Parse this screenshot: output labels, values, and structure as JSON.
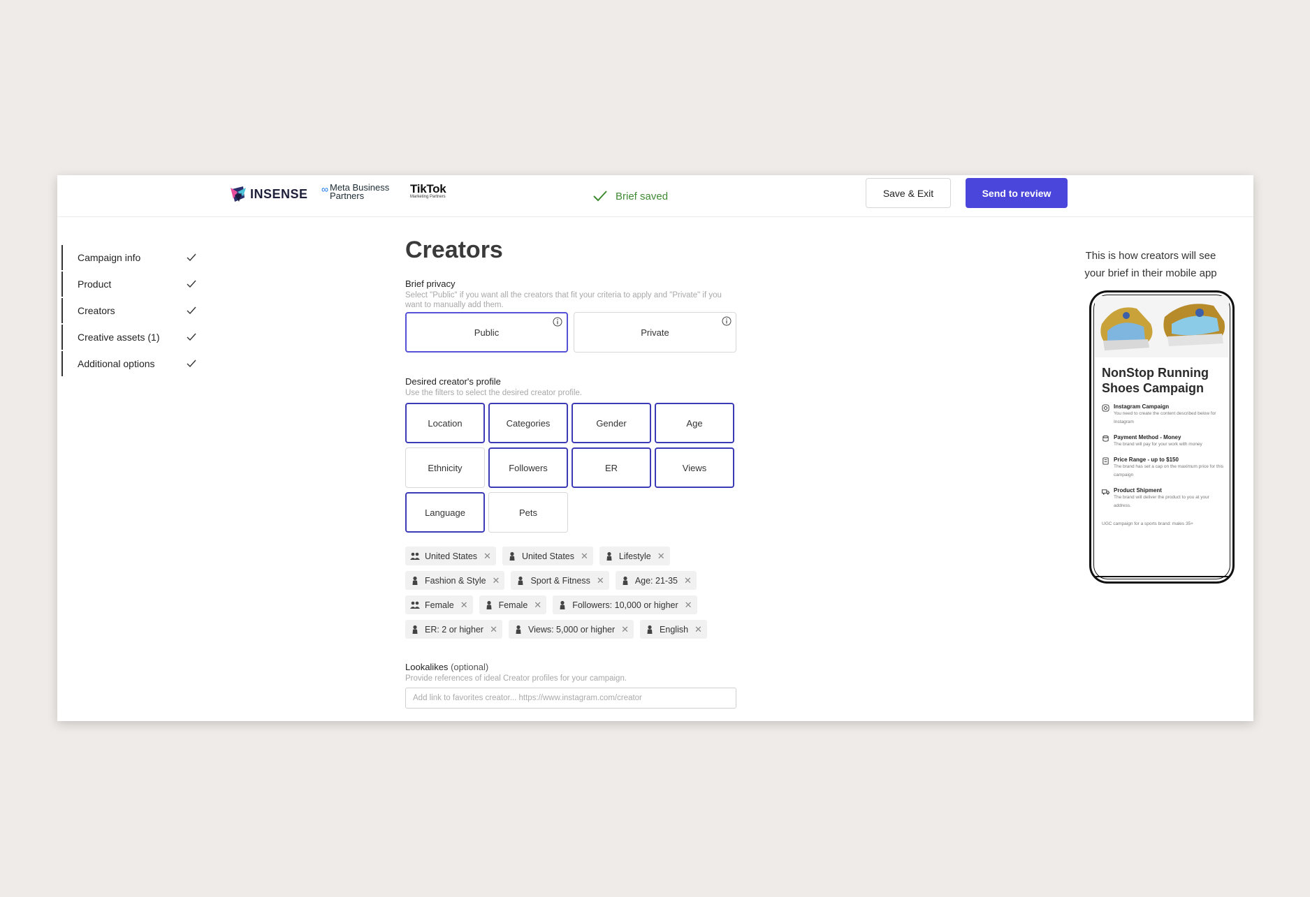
{
  "header": {
    "brand": "INSENSE",
    "meta_partner": [
      "Meta Business",
      "Partners"
    ],
    "meta_symbol": "∞",
    "tiktok_name": "TikTok",
    "tiktok_sub": "Marketing Partners",
    "saved_status": "Brief saved",
    "save_exit_label": "Save & Exit",
    "send_review_label": "Send to review"
  },
  "sidebar": {
    "items": [
      {
        "label": "Campaign info"
      },
      {
        "label": "Product"
      },
      {
        "label": "Creators"
      },
      {
        "label": "Creative assets (1)"
      },
      {
        "label": "Additional options"
      }
    ]
  },
  "main": {
    "title": "Creators",
    "privacy": {
      "label": "Brief privacy",
      "help": "Select \"Public\" if you want all the creators that fit your criteria to apply and \"Private\" if you want to manually add them.",
      "options": [
        {
          "label": "Public",
          "selected": true
        },
        {
          "label": "Private",
          "selected": false
        }
      ]
    },
    "profile": {
      "label": "Desired creator's profile",
      "help": "Use the filters to select the desired creator profile.",
      "filters": [
        {
          "label": "Location",
          "active": true
        },
        {
          "label": "Categories",
          "active": true
        },
        {
          "label": "Gender",
          "active": true
        },
        {
          "label": "Age",
          "active": true
        },
        {
          "label": "Ethnicity",
          "active": false
        },
        {
          "label": "Followers",
          "active": true
        },
        {
          "label": "ER",
          "active": true
        },
        {
          "label": "Views",
          "active": true
        },
        {
          "label": "Language",
          "active": true
        },
        {
          "label": "Pets",
          "active": false
        }
      ]
    },
    "tags": [
      {
        "icon": "audience-icon",
        "label": "United States"
      },
      {
        "icon": "creator-icon",
        "label": "United States"
      },
      {
        "icon": "creator-icon",
        "label": "Lifestyle"
      },
      {
        "icon": "creator-icon",
        "label": "Fashion & Style"
      },
      {
        "icon": "creator-icon",
        "label": "Sport & Fitness"
      },
      {
        "icon": "creator-icon",
        "label": "Age: 21-35"
      },
      {
        "icon": "audience-icon",
        "label": "Female"
      },
      {
        "icon": "creator-icon",
        "label": "Female"
      },
      {
        "icon": "creator-icon",
        "label": "Followers: 10,000 or higher"
      },
      {
        "icon": "creator-icon",
        "label": "ER: 2 or higher"
      },
      {
        "icon": "creator-icon",
        "label": "Views: 5,000 or higher"
      },
      {
        "icon": "creator-icon",
        "label": "English"
      }
    ],
    "lookalikes": {
      "label": "Lookalikes",
      "optional": "(optional)",
      "help": "Provide references of ideal Creator profiles for your campaign.",
      "placeholder": "Add link to favorites creator... https://www.instagram.com/creator"
    }
  },
  "preview": {
    "caption": "This is how creators will see your brief in their mobile app",
    "title": "NonStop Running Shoes Campaign",
    "items": [
      {
        "icon": "instagram-icon",
        "title": "Instagram Campaign",
        "sub": "You need to create the content described below for Instagram"
      },
      {
        "icon": "payment-icon",
        "title": "Payment Method - Money",
        "sub": "The brand will pay for your work with money"
      },
      {
        "icon": "price-icon",
        "title": "Price Range - up to $150",
        "sub": "The brand has set a cap on the maximum price for this campaign"
      },
      {
        "icon": "shipment-icon",
        "title": "Product Shipment",
        "sub": "The brand will deliver the product to you at your address."
      }
    ],
    "footer": "UGC campaign for a sports brand: males 35+"
  },
  "colors": {
    "accent": "#4a46db",
    "selected_border": "#5552d8",
    "success": "#3f8a33",
    "background": "#efebe8"
  }
}
